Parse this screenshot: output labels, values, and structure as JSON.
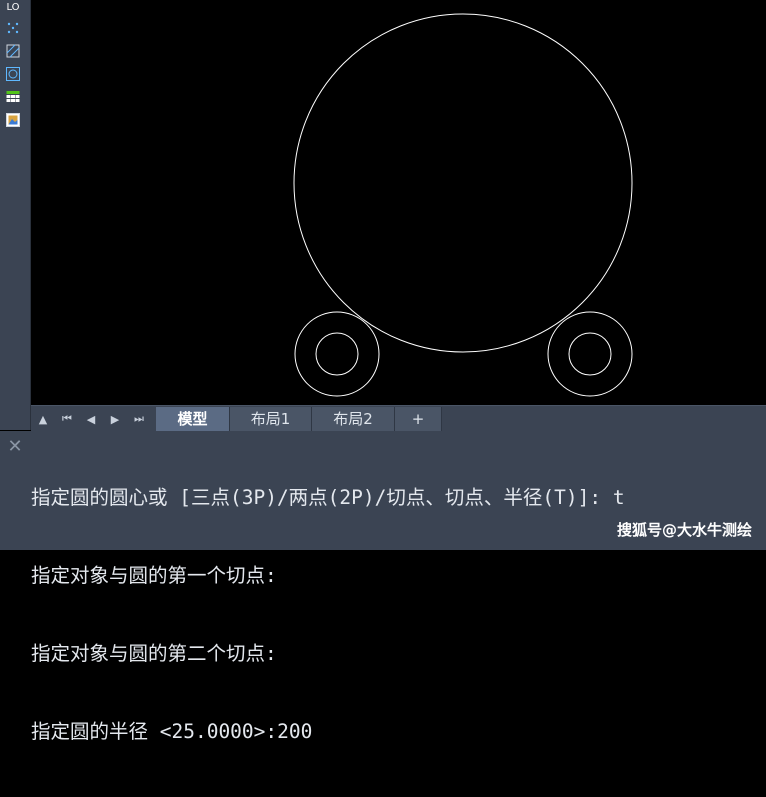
{
  "toolbar": {
    "tools": [
      {
        "name": "text-tool-icon"
      },
      {
        "name": "point-style-icon"
      },
      {
        "name": "hatch-icon"
      },
      {
        "name": "circle-wipeout-icon"
      },
      {
        "name": "table-icon"
      },
      {
        "name": "image-icon"
      }
    ],
    "text_tool_label": "LO"
  },
  "tabs": {
    "items": [
      {
        "label": "模型",
        "active": true
      },
      {
        "label": "布局1",
        "active": false
      },
      {
        "label": "布局2",
        "active": false
      },
      {
        "label": "+",
        "active": false
      }
    ]
  },
  "command": {
    "lines": [
      "指定圆的圆心或 [三点(3P)/两点(2P)/切点、切点、半径(T)]: t",
      "指定对象与圆的第一个切点:",
      "指定对象与圆的第二个切点:",
      "指定圆的半径 <25.0000>:200"
    ]
  },
  "watermark": "搜狐号@大水牛测绘",
  "colors": {
    "canvas": "#000000",
    "panel": "#3b4453",
    "active_tab": "#5b6b84",
    "geometry": "#ffffff"
  }
}
